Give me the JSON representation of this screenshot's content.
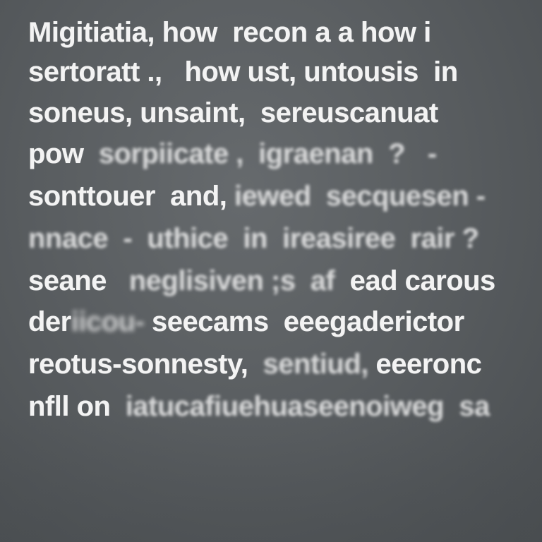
{
  "lines": [
    {
      "segments": [
        {
          "text": "Migitiatia, how  recon a a how i",
          "style": "sharp"
        }
      ]
    },
    {
      "segments": [
        {
          "text": "sertoratt ., ",
          "style": "sharp"
        },
        {
          "text": "  how ust, untousis  in",
          "style": "sharp"
        }
      ]
    },
    {
      "segments": [
        {
          "text": "soneus, unsaint,  sereuscanuat",
          "style": "sharp"
        }
      ]
    },
    {
      "segments": [
        {
          "text": "pow  ",
          "style": "sharp"
        },
        {
          "text": "sorpiicate ,  igraenan  ?   -",
          "style": "blur"
        }
      ]
    },
    {
      "segments": [
        {
          "text": "sonttouer  and, ",
          "style": "sharp"
        },
        {
          "text": "iewed  secquesen -",
          "style": "blur"
        }
      ]
    },
    {
      "segments": [
        {
          "text": "nnace  -  uthice  in  ireasiree  rair ?",
          "style": "blur"
        }
      ]
    },
    {
      "segments": [
        {
          "text": "seane   ",
          "style": "sharp"
        },
        {
          "text": "neglisiven ;s  af  ",
          "style": "blur"
        },
        {
          "text": "ead carous",
          "style": "sharp"
        }
      ]
    },
    {
      "segments": [
        {
          "text": "der",
          "style": "sharp"
        },
        {
          "text": "iicou- ",
          "style": "blur-heavy"
        },
        {
          "text": "seecams  eeegaderictor",
          "style": "sharp"
        }
      ]
    },
    {
      "segments": [
        {
          "text": "reotus-sonnesty,  ",
          "style": "sharp"
        },
        {
          "text": "sentiud, ",
          "style": "blur"
        },
        {
          "text": "eeeronc",
          "style": "sharp"
        }
      ]
    },
    {
      "segments": [
        {
          "text": "nfll on  ",
          "style": "sharp"
        },
        {
          "text": "iatucafiuehuaseenoiweg  sa",
          "style": "blur"
        }
      ]
    }
  ]
}
